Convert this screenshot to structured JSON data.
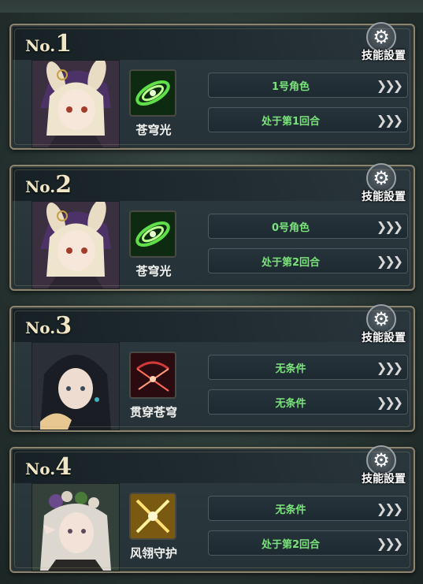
{
  "gear_label": "技能設置",
  "cards": [
    {
      "rank_prefix": "No.",
      "rank_num": "1",
      "skill": "苍穹光",
      "conditions": [
        "1号角色",
        "处于第1回合"
      ]
    },
    {
      "rank_prefix": "No.",
      "rank_num": "2",
      "skill": "苍穹光",
      "conditions": [
        "0号角色",
        "处于第2回合"
      ]
    },
    {
      "rank_prefix": "No.",
      "rank_num": "3",
      "skill": "贯穿苍穹",
      "conditions": [
        "无条件",
        "无条件"
      ]
    },
    {
      "rank_prefix": "No.",
      "rank_num": "4",
      "skill": "风翎守护",
      "conditions": [
        "无条件",
        "处于第2回合"
      ]
    }
  ],
  "colors": {
    "condition_text": "#7be37b",
    "rank_text": "#f1e6c4",
    "frame": "#8a8470"
  },
  "icons": {
    "gear": "gear-icon",
    "arrows": "triple-chevron-right-icon"
  }
}
